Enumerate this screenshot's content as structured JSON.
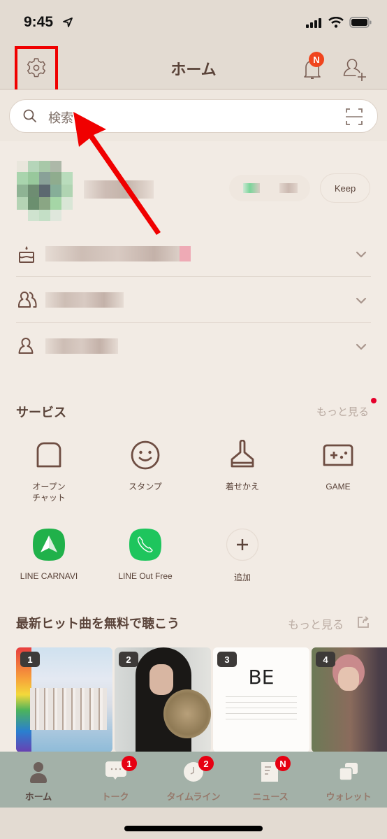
{
  "status_bar": {
    "time": "9:45",
    "location_icon": "location-arrow-icon",
    "signal_icon": "cellular-signal-icon",
    "wifi_icon": "wifi-icon",
    "battery_icon": "battery-icon"
  },
  "header": {
    "title": "ホーム",
    "settings_icon": "gear-icon",
    "notifications_icon": "bell-icon",
    "notifications_badge": "N",
    "add_friend_icon": "add-friend-icon"
  },
  "search": {
    "placeholder": "検索",
    "search_icon": "search-icon",
    "scan_icon": "qr-scan-icon"
  },
  "profile": {
    "name": "(blurred)",
    "keep_label": "Keep"
  },
  "info_rows": [
    {
      "icon": "birthday-cake-icon",
      "text": "(blurred)"
    },
    {
      "icon": "groups-icon",
      "text": "(blurred)"
    },
    {
      "icon": "friend-icon",
      "text": "(blurred)"
    }
  ],
  "services": {
    "title": "サービス",
    "more_label": "もっと見る",
    "items": [
      {
        "icon": "open-chat-icon",
        "label": "オープン\nチャット"
      },
      {
        "icon": "sticker-icon",
        "label": "スタンプ"
      },
      {
        "icon": "theme-icon",
        "label": "着せかえ"
      },
      {
        "icon": "game-icon",
        "label": "GAME"
      },
      {
        "icon": "line-carnavi-icon",
        "label": "LINE CARNAVI"
      },
      {
        "icon": "line-out-free-icon",
        "label": "LINE Out Free"
      },
      {
        "icon": "add-icon",
        "label": "追加"
      }
    ]
  },
  "music": {
    "title": "最新ヒット曲を無料で聴こう",
    "more_label": "もっと見る",
    "external_icon": "external-link-icon",
    "albums": [
      {
        "rank": "1"
      },
      {
        "rank": "2"
      },
      {
        "rank": "3",
        "cover_text": "BE"
      },
      {
        "rank": "4"
      }
    ]
  },
  "tabbar": {
    "tabs": [
      {
        "label": "ホーム",
        "icon": "home-person-icon",
        "active": true
      },
      {
        "label": "トーク",
        "icon": "chat-bubble-icon",
        "badge": "1"
      },
      {
        "label": "タイムライン",
        "icon": "timeline-clock-icon",
        "badge": "2"
      },
      {
        "label": "ニュース",
        "icon": "news-icon",
        "badge": "N"
      },
      {
        "label": "ウォレット",
        "icon": "wallet-icon"
      }
    ]
  },
  "annotation": {
    "highlight_color": "#f00000",
    "arrow_color": "#f00000"
  }
}
